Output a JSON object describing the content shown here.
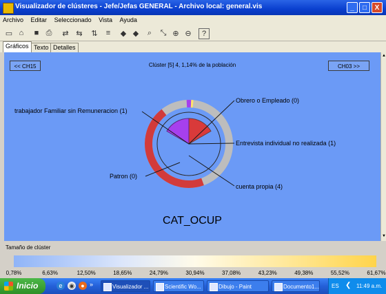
{
  "window": {
    "title": "Visualizador de clústeres - Jefe/Jefas GENERAL - Archivo local: general.vis",
    "minimize": "_",
    "maximize": "□",
    "close": "X"
  },
  "menu": [
    "Archivo",
    "Editar",
    "Seleccionado",
    "Vista",
    "Ayuda"
  ],
  "toolbar": {
    "icons": [
      "new-icon",
      "open-icon",
      "save-icon",
      "print-icon",
      "swap-icon",
      "back-swap-icon",
      "sort-icon",
      "filter-icon",
      "arrow-left-icon",
      "arrow-right-icon",
      "find-icon",
      "zoom-fit-icon",
      "zoom-in-icon",
      "zoom-out-icon",
      "help-icon"
    ],
    "glyphs": [
      "▭",
      "⌂",
      "■",
      "⎙",
      "⇄",
      "⇆",
      "⇅",
      "≡",
      "◆",
      "◆",
      "⌕",
      "⤡",
      "⊕",
      "⊖",
      "?"
    ]
  },
  "tabs": [
    "Gráficos",
    "Texto",
    "Detalles"
  ],
  "nav": {
    "prev": "<< CH15",
    "next": "CH03 >>"
  },
  "cluster_header": "Clúster [5] 4, 1,14% de la población",
  "chart_title": "CAT_OCUP",
  "chart_data": {
    "type": "pie",
    "title": "CAT_OCUP",
    "inner_slices": [
      {
        "label": "Obrero o Empleado (0)",
        "value": 0,
        "color": "#c62f2f"
      },
      {
        "label": "trabajador Familiar sin Remuneracion (1)",
        "value": 1,
        "color": "#a640ee"
      },
      {
        "label": "Entrevista individual no realizada (1)",
        "value": 1,
        "color": "#d93a3a"
      },
      {
        "label": "cuenta propia (4)",
        "value": 4,
        "color": "#6b9af6"
      },
      {
        "label": "Patron (0)",
        "value": 0,
        "color": "#c62f2f"
      }
    ],
    "annotations": [
      "Obrero o Empleado (0)",
      "trabajador Familiar sin Remuneracion (1)",
      "Entrevista individual no realizada (1)",
      "Patron (0)",
      "cuenta propia (4)"
    ]
  },
  "cluster_size_label": "Tamaño de clúster",
  "scale_ticks": [
    "0,78%",
    "6,63%",
    "12,50%",
    "18,65%",
    "24,79%",
    "30,94%",
    "37,08%",
    "43,23%",
    "49,38%",
    "55,52%",
    "61,67%"
  ],
  "taskbar": {
    "start": "Inicio",
    "chevron": "»",
    "tasks": [
      "Visualizador ...",
      "Scientific Wo...",
      "Dibujo - Paint",
      "Documento1..."
    ],
    "lang": "ES",
    "time": "11:49 a.m."
  }
}
